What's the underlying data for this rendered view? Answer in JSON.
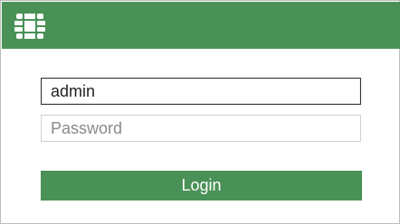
{
  "colors": {
    "brand": "#4a9157",
    "white": "#ffffff"
  },
  "header": {
    "logo_icon": "fortinet-logo-icon"
  },
  "login_form": {
    "username_value": "admin",
    "password_placeholder": "Password",
    "login_label": "Login"
  }
}
